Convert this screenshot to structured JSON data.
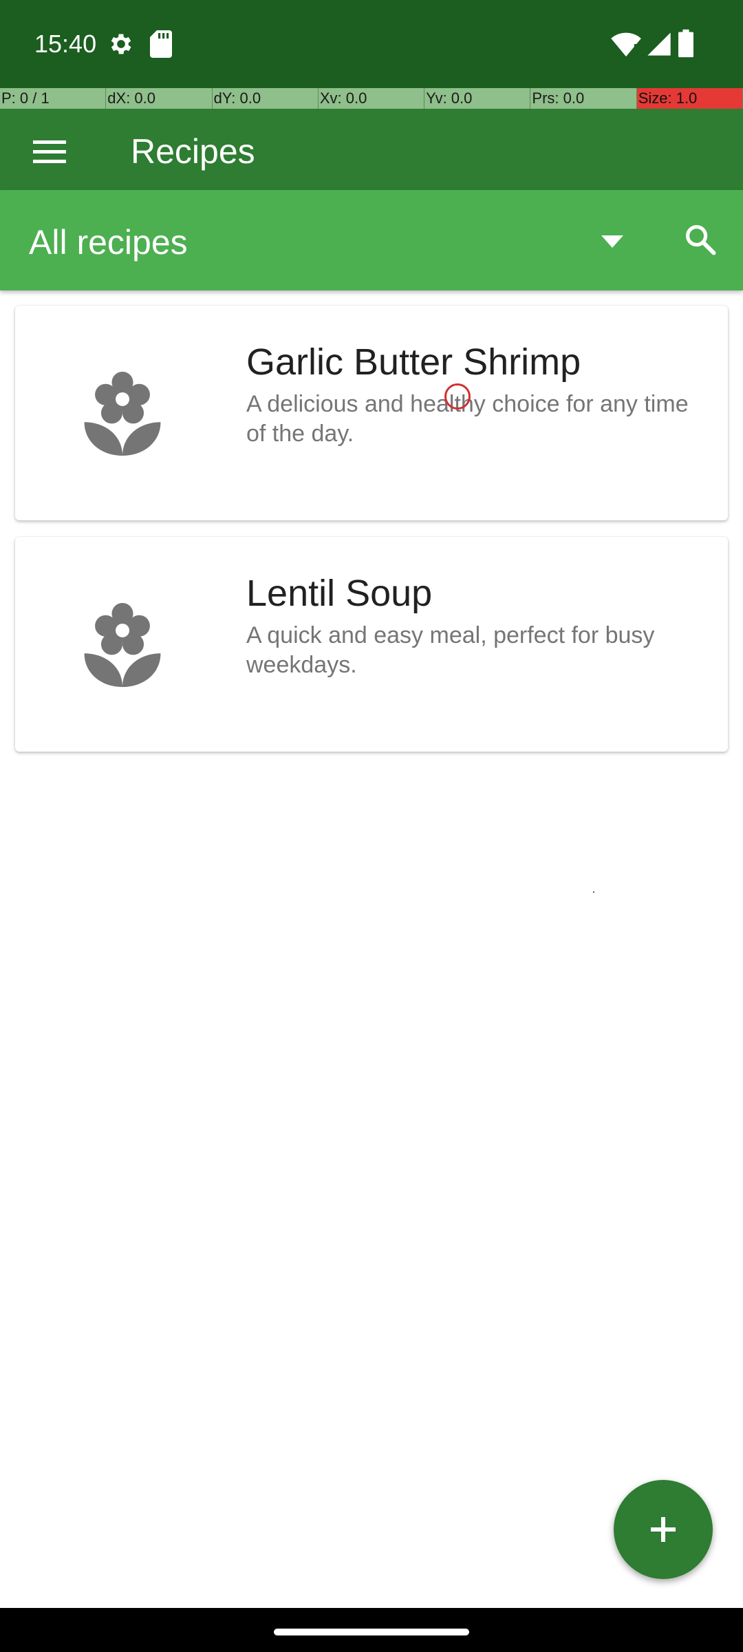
{
  "status_bar": {
    "time": "15:40",
    "icons": [
      "gear-icon",
      "sd-card-icon",
      "wifi-icon",
      "signal-icon",
      "battery-icon"
    ]
  },
  "debug_strip": {
    "cells": [
      "P: 0 / 1",
      "dX: 0.0",
      "dY: 0.0",
      "Xv: 0.0",
      "Yv: 0.0",
      "Prs: 0.0",
      "Size: 1.0"
    ]
  },
  "app_bar": {
    "title": "Recipes",
    "menu_icon": "hamburger-menu-icon"
  },
  "filter_bar": {
    "selected": "All recipes",
    "dropdown_icon": "arrow-drop-down-icon",
    "search_icon": "search-icon"
  },
  "recipes": [
    {
      "title": "Garlic Butter Shrimp",
      "description": "A delicious and healthy choice for any time of the day.",
      "icon": "flower-placeholder-icon"
    },
    {
      "title": "Lentil Soup",
      "description": "A quick and easy meal, perfect for busy weekdays.",
      "icon": "flower-placeholder-icon"
    }
  ],
  "fab": {
    "icon": "plus-icon"
  },
  "colors": {
    "status_bar": "#1b5e20",
    "app_bar": "#2e7d32",
    "filter_bar": "#4caf50",
    "fab": "#2e7d32",
    "touch_indicator": "#d32f2f"
  }
}
